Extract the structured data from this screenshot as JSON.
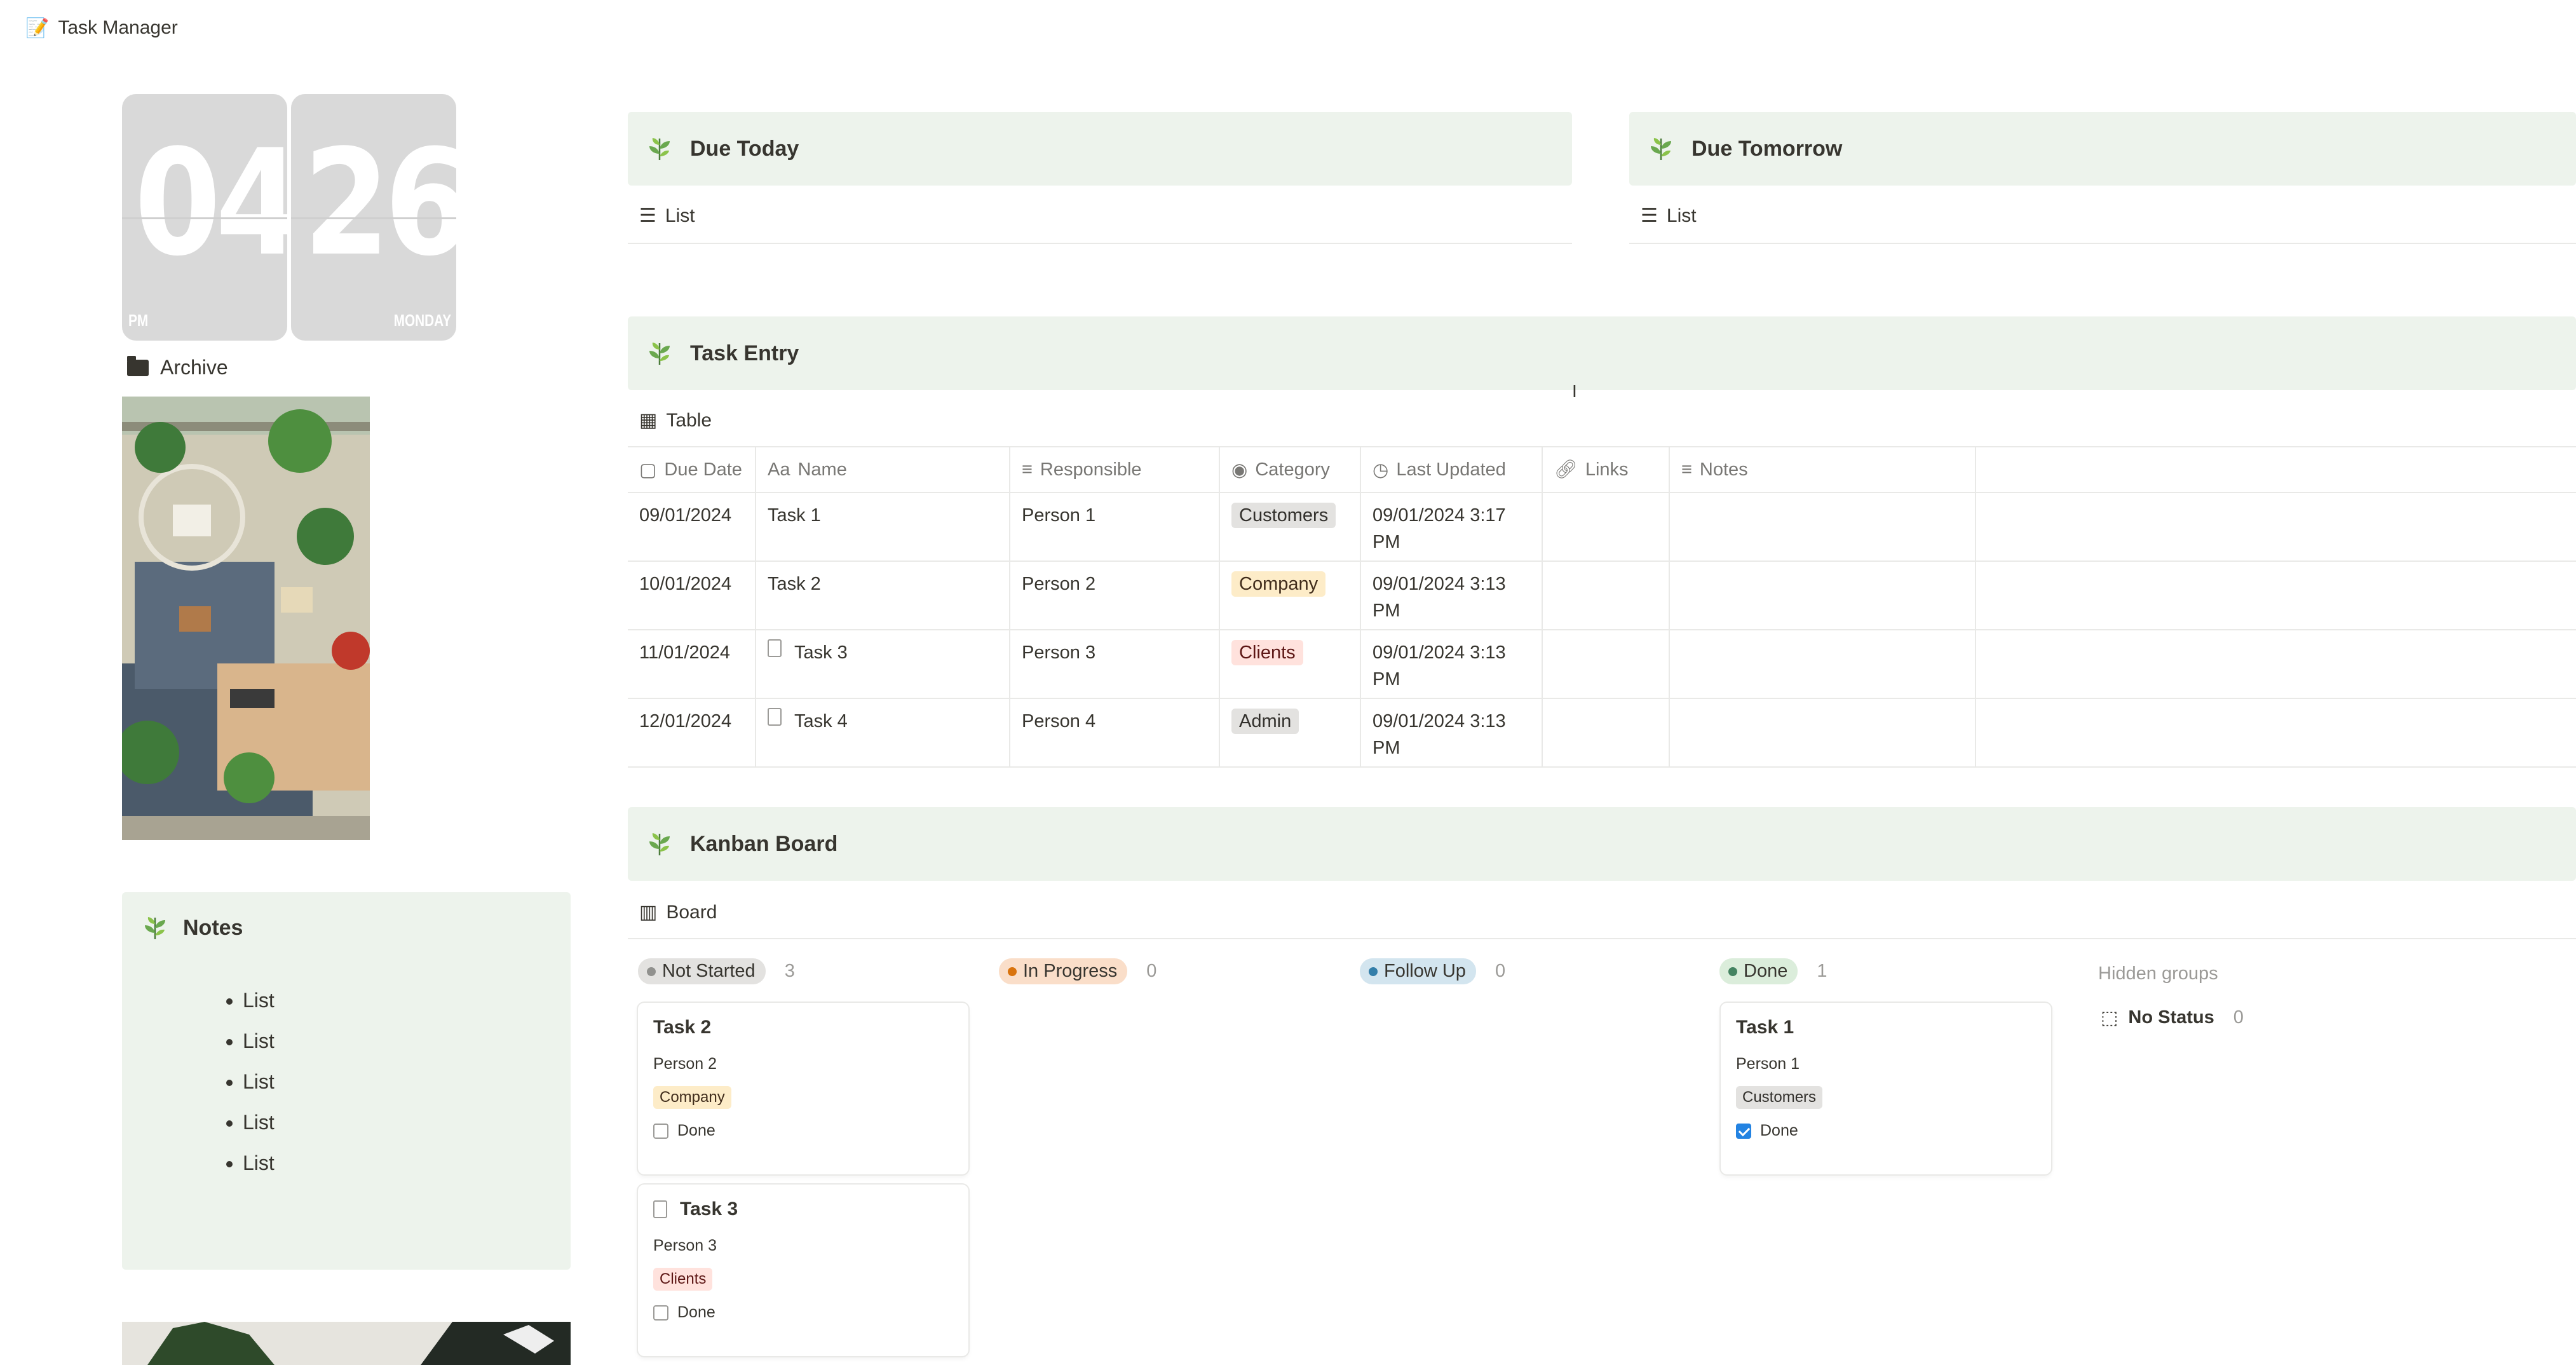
{
  "window": {
    "title": "Task Manager",
    "title_icon": "memo-pencil-icon"
  },
  "clock": {
    "hours": "04",
    "minutes": "26",
    "meridiem": "PM",
    "weekday": "MONDAY"
  },
  "archive": {
    "label": "Archive",
    "icon": "folder-icon"
  },
  "notes": {
    "title": "Notes",
    "items": [
      "List",
      "List",
      "List",
      "List",
      "List"
    ]
  },
  "due_today": {
    "title": "Due Today",
    "view": "List"
  },
  "due_tomorrow": {
    "title": "Due Tomorrow",
    "view": "List"
  },
  "task_entry": {
    "title": "Task Entry",
    "view": "Table",
    "columns": [
      "Due Date",
      "Name",
      "Responsible",
      "Category",
      "Last Updated",
      "Links",
      "Notes"
    ],
    "column_prefixes": {
      "name": "Aa"
    },
    "rows": [
      {
        "due": "09/01/2024",
        "name": "Task 1",
        "doc": false,
        "responsible": "Person 1",
        "category": "Customers",
        "cat_color": "gray",
        "updated_1": "09/01/2024 3:17",
        "updated_2": "PM"
      },
      {
        "due": "10/01/2024",
        "name": "Task 2",
        "doc": false,
        "responsible": "Person 2",
        "category": "Company",
        "cat_color": "yellow",
        "updated_1": "09/01/2024 3:13",
        "updated_2": "PM"
      },
      {
        "due": "11/01/2024",
        "name": "Task 3",
        "doc": true,
        "responsible": "Person 3",
        "category": "Clients",
        "cat_color": "red",
        "updated_1": "09/01/2024 3:13",
        "updated_2": "PM"
      },
      {
        "due": "12/01/2024",
        "name": "Task 4",
        "doc": true,
        "responsible": "Person 4",
        "category": "Admin",
        "cat_color": "gray",
        "updated_1": "09/01/2024 3:13",
        "updated_2": "PM"
      }
    ]
  },
  "kanban": {
    "title": "Kanban Board",
    "view": "Board",
    "groups": [
      {
        "label": "Not Started",
        "count": "3",
        "bg": "#e3e2e0",
        "dot": "#91918e"
      },
      {
        "label": "In Progress",
        "count": "0",
        "bg": "#fadec9",
        "dot": "#d9730d"
      },
      {
        "label": "Follow Up",
        "count": "0",
        "bg": "#d3e5ef",
        "dot": "#337ea9"
      },
      {
        "label": "Done",
        "count": "1",
        "bg": "#dbeddb",
        "dot": "#448361"
      }
    ],
    "hidden_groups_label": "Hidden groups",
    "no_status": {
      "label": "No Status",
      "count": "0"
    },
    "cards": [
      {
        "title": "Task 2",
        "person": "Person 2",
        "tag": "Company",
        "tag_color": "yellow",
        "done_label": "Done",
        "checked": false
      },
      {
        "title": "Task 3",
        "person": "Person 3",
        "tag": "Clients",
        "tag_color": "red",
        "done_label": "Done",
        "checked": false
      },
      {
        "title": "Task 1",
        "person": "Person 1",
        "tag": "Customers",
        "tag_color": "gray",
        "done_label": "Done",
        "checked": true
      }
    ]
  },
  "colors": {
    "callout_bg": "#edf3ec",
    "text": "#37352f",
    "muted": "#787774",
    "border": "#e9e9e7",
    "checkbox_blue": "#2383e2"
  }
}
